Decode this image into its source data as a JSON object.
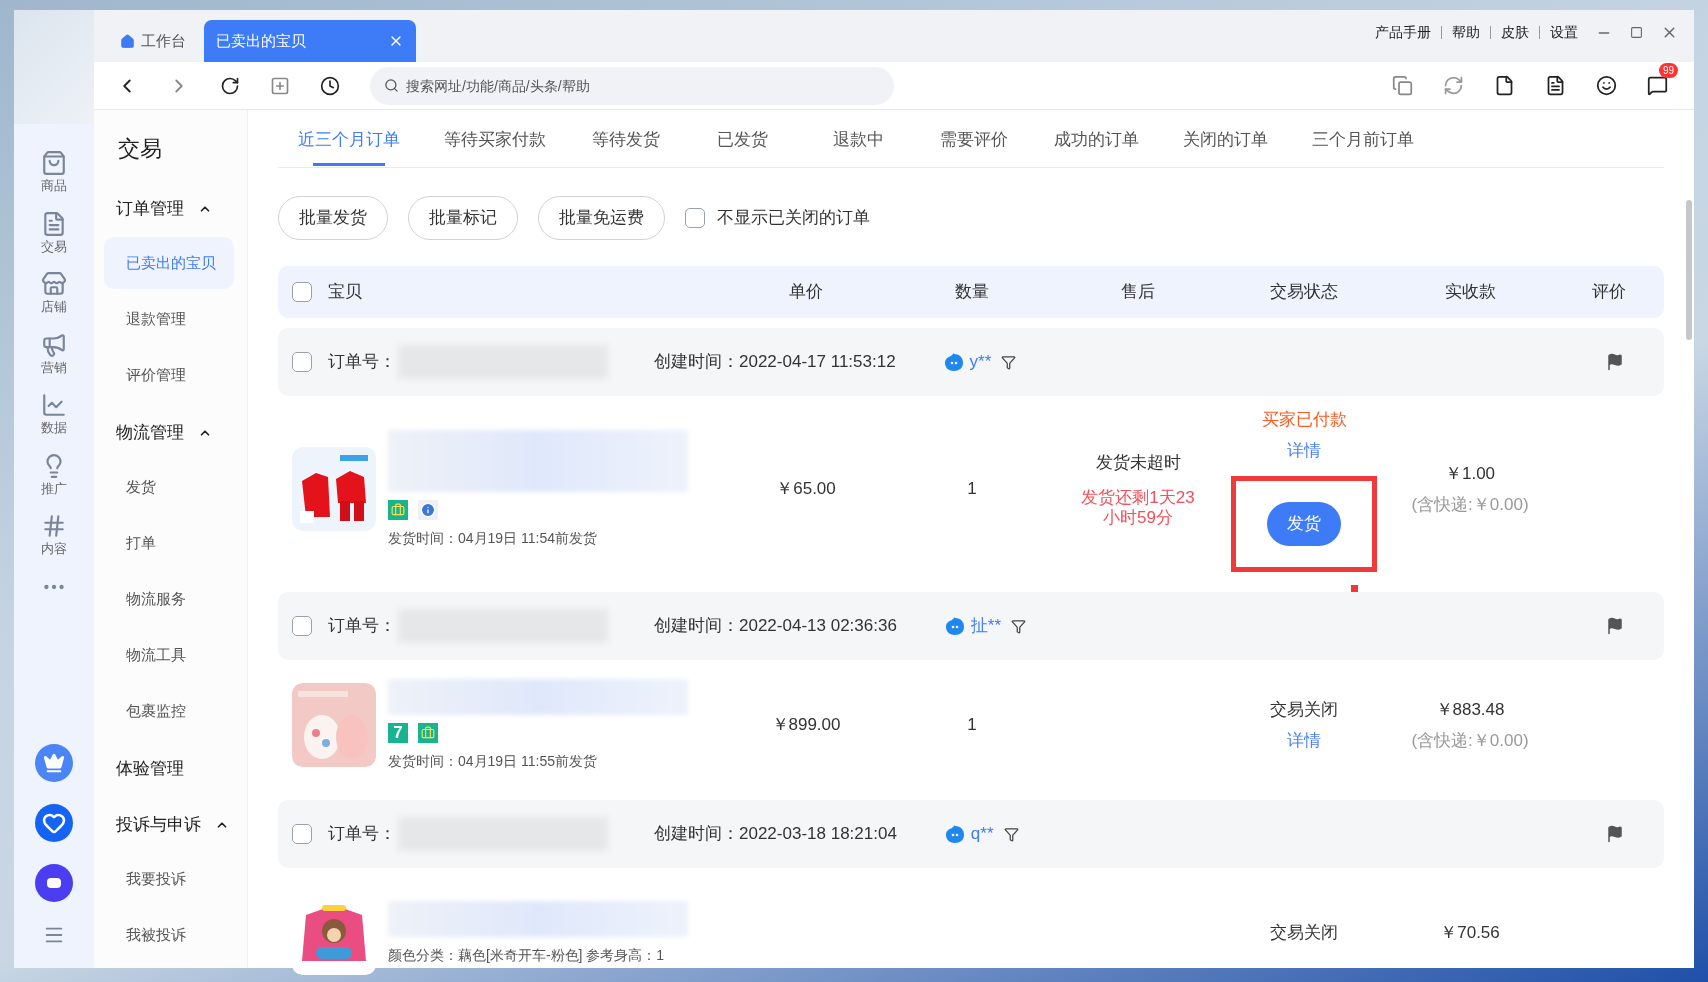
{
  "window": {
    "tabs": [
      {
        "label": "工作台",
        "selected": false,
        "kind": "home"
      },
      {
        "label": "已卖出的宝贝",
        "selected": true,
        "kind": "page"
      }
    ],
    "links": [
      "产品手册",
      "帮助",
      "皮肤",
      "设置"
    ]
  },
  "toolbar": {
    "search_placeholder": "搜索网址/功能/商品/头条/帮助",
    "badge": "99"
  },
  "rail": {
    "items": [
      {
        "label": "商品",
        "kind": "bag"
      },
      {
        "label": "交易",
        "kind": "doc"
      },
      {
        "label": "店铺",
        "kind": "store"
      },
      {
        "label": "营销",
        "kind": "megaphone"
      },
      {
        "label": "数据",
        "kind": "chart"
      },
      {
        "label": "推广",
        "kind": "bulb"
      },
      {
        "label": "内容",
        "kind": "hash"
      }
    ],
    "apps": [
      {
        "kind": "crown"
      },
      {
        "kind": "heart"
      },
      {
        "kind": "logo"
      }
    ]
  },
  "nav": {
    "title": "交易",
    "groups": [
      {
        "label": "订单管理",
        "expanded": true,
        "children": [
          {
            "label": "已卖出的宝贝",
            "selected": true
          },
          {
            "label": "退款管理",
            "selected": false
          },
          {
            "label": "评价管理",
            "selected": false
          }
        ]
      },
      {
        "label": "物流管理",
        "expanded": true,
        "children": [
          {
            "label": "发货",
            "selected": false
          },
          {
            "label": "打单",
            "selected": false
          },
          {
            "label": "物流服务",
            "selected": false
          },
          {
            "label": "物流工具",
            "selected": false
          },
          {
            "label": "包裹监控",
            "selected": false
          }
        ]
      },
      {
        "label": "体验管理"
      },
      {
        "label": "投诉与申诉",
        "expanded": true,
        "children": [
          {
            "label": "我要投诉",
            "selected": false
          },
          {
            "label": "我被投诉",
            "selected": false
          }
        ]
      }
    ]
  },
  "order_tabs": [
    {
      "label": "近三个月订单",
      "selected": true
    },
    {
      "label": "等待买家付款",
      "selected": false
    },
    {
      "label": "等待发货",
      "selected": false
    },
    {
      "label": "已发货",
      "selected": false
    },
    {
      "label": "退款中",
      "selected": false
    },
    {
      "label": "需要评价",
      "selected": false
    },
    {
      "label": "成功的订单",
      "selected": false
    },
    {
      "label": "关闭的订单",
      "selected": false
    },
    {
      "label": "三个月前订单",
      "selected": false
    }
  ],
  "actions": [
    "批量发货",
    "批量标记",
    "批量免运费"
  ],
  "hide_closed": {
    "label": "不显示已关闭的订单",
    "checked": false
  },
  "table": {
    "select_all": false,
    "columns": [
      "宝贝",
      "单价",
      "数量",
      "售后",
      "交易状态",
      "实收款",
      "评价"
    ],
    "orders": [
      {
        "checked": false,
        "order_label": "订单号：",
        "created": "创建时间：2022-04-17 11:53:12",
        "buyer": "y**",
        "item": {
          "tags": [
            {
              "kind": "bag"
            },
            {
              "kind": "info"
            }
          ],
          "line": "发货时间：04月19日 11:54前发货",
          "price": "￥65.00",
          "qty": "1",
          "after_sale": "发货未超时",
          "countdown": "发货还剩1天23\n小时59分",
          "status": "买家已付款",
          "color": "#ff5a1f",
          "detail": "详情",
          "action": "发货",
          "highlighted": true,
          "received": "￥1.00",
          "shipping": "(含快递:￥0.00)"
        }
      },
      {
        "checked": false,
        "order_label": "订单号：",
        "created": "创建时间：2022-04-13 02:36:36",
        "buyer": "扯**",
        "item": {
          "tags": [
            {
              "kind": "badge",
              "text": "7"
            },
            {
              "kind": "bag"
            }
          ],
          "line": "发货时间：04月19日 11:55前发货",
          "price": "￥899.00",
          "qty": "1",
          "status": "交易关闭",
          "color": "#333333",
          "detail": "详情",
          "highlighted": false,
          "received": "￥883.48",
          "shipping": "(含快递:￥0.00)"
        }
      },
      {
        "checked": false,
        "order_label": "订单号：",
        "created": "创建时间：2022-03-18 18:21:04",
        "buyer": "q**",
        "item": {
          "line": "颜色分类：藕色[米奇开车-粉色]  参考身高：1",
          "status": "交易关闭",
          "color": "#333333",
          "highlighted": false,
          "received": "￥70.56"
        }
      }
    ]
  }
}
